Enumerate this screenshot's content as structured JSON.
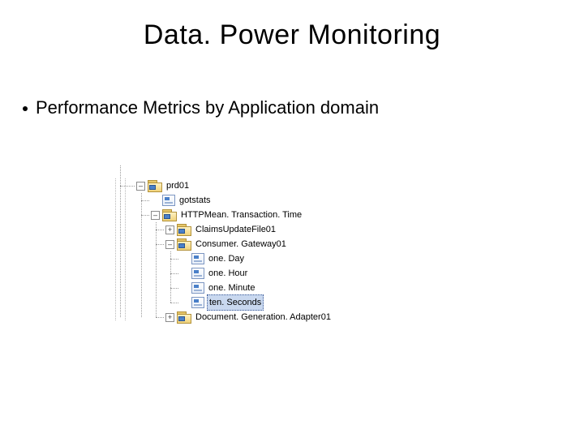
{
  "title": "Data. Power Monitoring",
  "bullet": "Performance Metrics by Application domain",
  "toggles": {
    "plus": "+",
    "minus": "–"
  },
  "tree": {
    "root": {
      "label": "prd01",
      "children": {
        "gotstats": {
          "label": "gotstats"
        },
        "httpmean": {
          "label": "HTTPMean. Transaction. Time",
          "children": {
            "claims": {
              "label": "ClaimsUpdateFile01"
            },
            "consumer": {
              "label": "Consumer. Gateway01",
              "children": {
                "oneDay": {
                  "label": "one. Day"
                },
                "oneHour": {
                  "label": "one. Hour"
                },
                "oneMinute": {
                  "label": "one. Minute"
                },
                "tenSeconds": {
                  "label": "ten. Seconds"
                }
              }
            },
            "docgen": {
              "label": "Document. Generation. Adapter01"
            }
          }
        }
      }
    }
  }
}
